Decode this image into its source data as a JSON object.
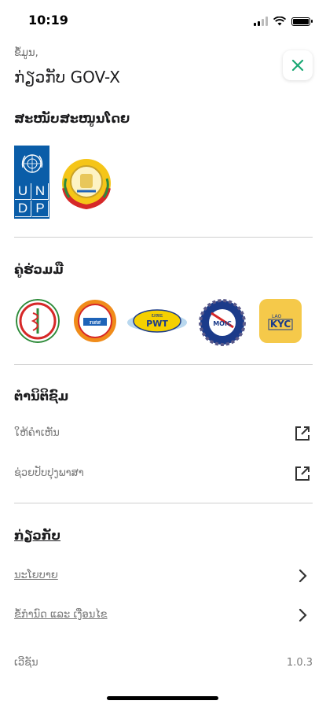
{
  "status": {
    "time": "10:19",
    "icons": [
      "signal-icon",
      "wifi-icon",
      "battery-icon"
    ]
  },
  "header": {
    "subtitle": "ຂໍ້ມູນ,",
    "title": "ກ່ຽວກັບ GOV-X",
    "close_icon": "close-icon"
  },
  "sponsors": {
    "heading": "ສະໜັບສະໜູນໂດຍ",
    "logos": [
      {
        "name": "undp-logo",
        "letters": [
          "U",
          "N",
          "D",
          "P"
        ]
      },
      {
        "name": "government-emblem-logo"
      }
    ]
  },
  "partners": {
    "heading": "ຄູ່ຮ່ວມມື",
    "logos": [
      {
        "name": "ministry-of-health-logo"
      },
      {
        "name": "ministry-logo",
        "text": "ກສສ"
      },
      {
        "name": "pwt-logo",
        "text": "PWT",
        "top_text": "ຍທຂ"
      },
      {
        "name": "moic-logo",
        "text": "MOIC"
      },
      {
        "name": "lao-kyc-logo",
        "text_small": "LAO",
        "text": "KYC"
      }
    ]
  },
  "feedback": {
    "heading": "ຕຳນິຕິຊົມ",
    "items": [
      {
        "label": "ໃຫ້ຄຳເຫັນ",
        "icon": "external-link-icon"
      },
      {
        "label": "ຊ່ວຍປັບປຸງພາສາ",
        "icon": "external-link-icon"
      }
    ]
  },
  "about": {
    "heading": "ກ່ຽວກັບ",
    "items": [
      {
        "label": "ນະໂຍບາຍ",
        "icon": "chevron-right-icon"
      },
      {
        "label": "ຂໍ້ກຳນົດ ແລະ ເງື່ອນໄຂ",
        "icon": "chevron-right-icon"
      }
    ],
    "version_label": "ເວີຊັນ",
    "version_value": "1.0.3"
  },
  "colors": {
    "accent": "#1aa874",
    "undp_blue": "#0a5da8",
    "divider": "#cfcfcf",
    "muted_text": "#7a7a7a"
  }
}
